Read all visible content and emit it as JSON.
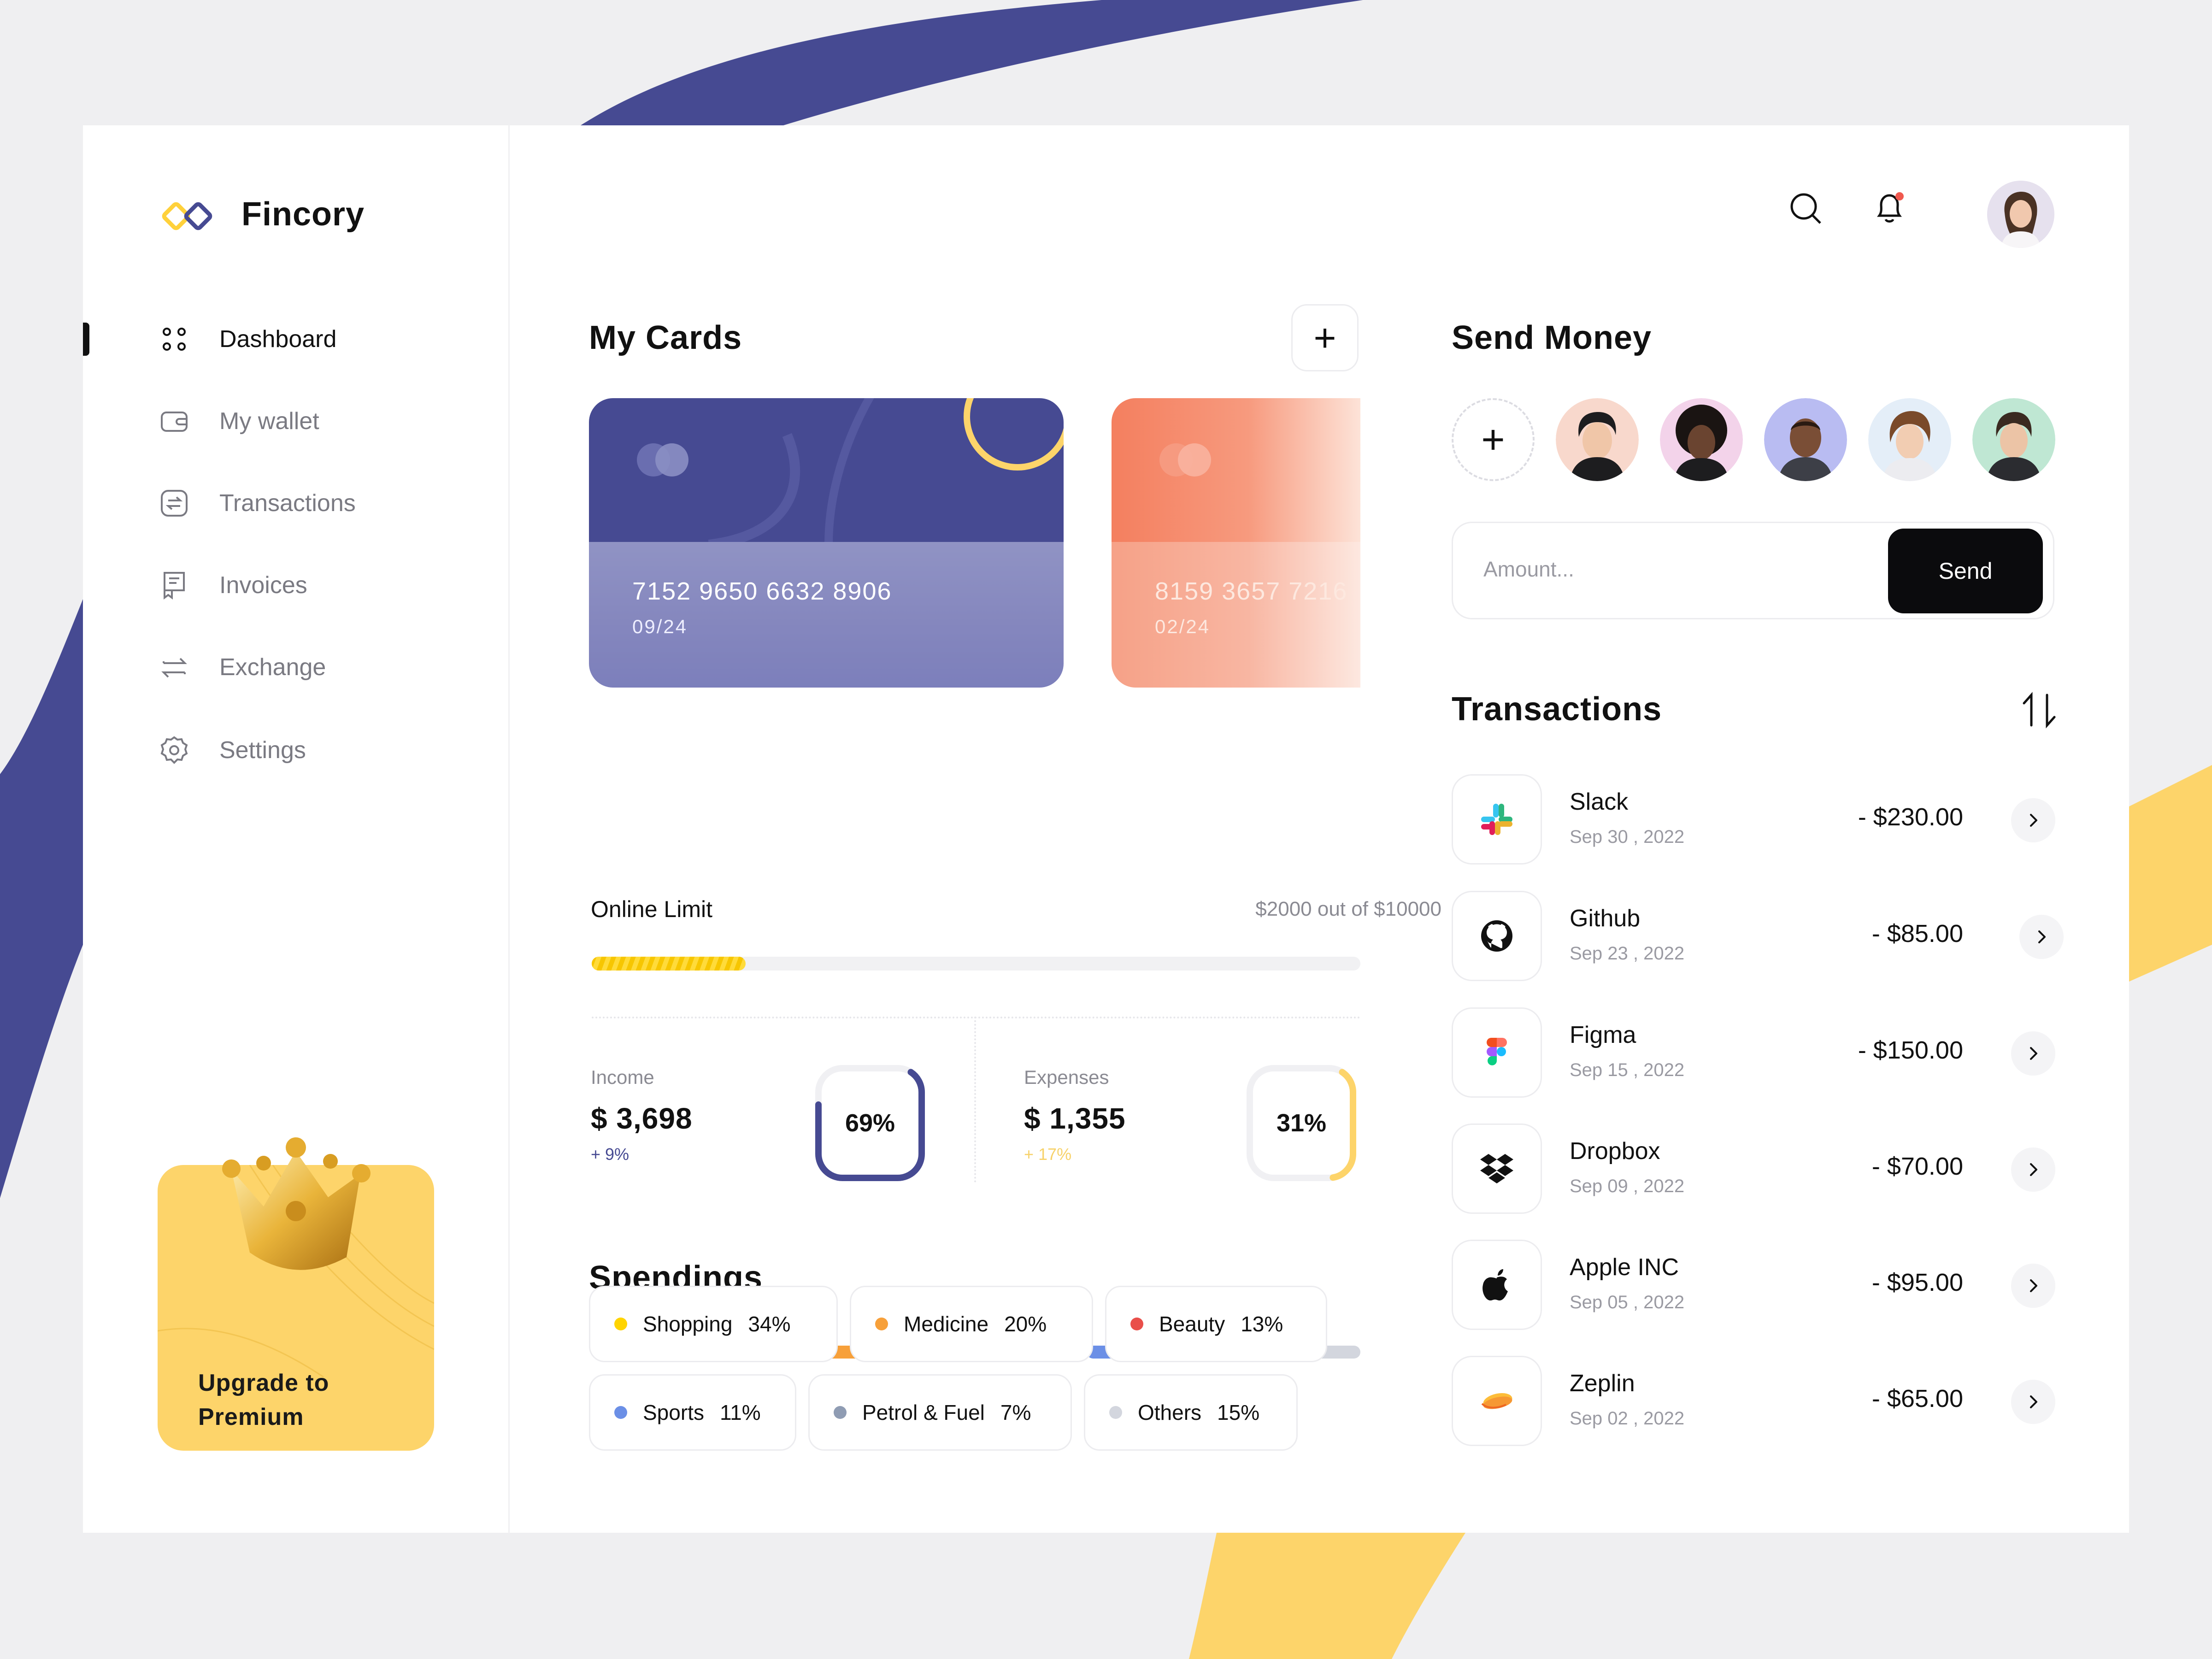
{
  "brand": {
    "name": "Fincory"
  },
  "colors": {
    "indigo": "#464a92",
    "yellow": "#fdd46a",
    "card_orange": "#f47f5f",
    "ink": "#111111",
    "muted": "#7a7a82"
  },
  "sidebar": {
    "items": [
      {
        "label": "Dashboard",
        "icon": "grid-icon",
        "active": true
      },
      {
        "label": "My wallet",
        "icon": "wallet-icon",
        "active": false
      },
      {
        "label": "Transactions",
        "icon": "transfer-icon",
        "active": false
      },
      {
        "label": "Invoices",
        "icon": "invoice-icon",
        "active": false
      },
      {
        "label": "Exchange",
        "icon": "exchange-icon",
        "active": false
      },
      {
        "label": "Settings",
        "icon": "gear-icon",
        "active": false
      }
    ],
    "premium": {
      "label": "Upgrade to Premium",
      "icon": "crown-icon"
    }
  },
  "header": {
    "icons": [
      "search-icon",
      "bell-icon",
      "avatar"
    ],
    "notification_dot": true
  },
  "cards_section": {
    "title": "My Cards",
    "add_label": "+",
    "cards": [
      {
        "number": "7152 9650 6632 8906",
        "expiry": "09/24",
        "color": "#464a92"
      },
      {
        "number": "8159 3657 7216",
        "expiry": "02/24",
        "color": "#f47f5f"
      }
    ]
  },
  "online_limit": {
    "label": "Online Limit",
    "value": "$2000 out of $10000",
    "progress": 0.2
  },
  "stats": {
    "income": {
      "label": "Income",
      "value": "$ 3,698",
      "delta": "+ 9%",
      "percent_label": "69%",
      "percent": 0.69
    },
    "expenses": {
      "label": "Expenses",
      "value": "$ 1,355",
      "delta": "+ 17%",
      "percent_label": "31%",
      "percent": 0.31
    }
  },
  "spendings": {
    "title": "Spendings",
    "categories": [
      {
        "name": "Shopping",
        "pct": "34%",
        "color": "#ffd400"
      },
      {
        "name": "Medicine",
        "pct": "20%",
        "color": "#f7a03a"
      },
      {
        "name": "Beauty",
        "pct": "13%",
        "color": "#e94f4a"
      },
      {
        "name": "Sports",
        "pct": "11%",
        "color": "#6b8fe6"
      },
      {
        "name": "Petrol & Fuel",
        "pct": "7%",
        "color": "#8f9cb3"
      },
      {
        "name": "Others",
        "pct": "15%",
        "color": "#d3d6de"
      }
    ]
  },
  "send_money": {
    "title": "Send Money",
    "add_label": "+",
    "amount_placeholder": "Amount...",
    "send_label": "Send"
  },
  "transactions": {
    "title": "Transactions",
    "items": [
      {
        "name": "Slack",
        "date": "Sep 30 , 2022",
        "amount": "- $230.00",
        "icon": "slack-icon"
      },
      {
        "name": "Github",
        "date": "Sep 23 , 2022",
        "amount": "- $85.00",
        "icon": "github-icon"
      },
      {
        "name": "Figma",
        "date": "Sep 15 , 2022",
        "amount": "- $150.00",
        "icon": "figma-icon"
      },
      {
        "name": "Dropbox",
        "date": "Sep 09 , 2022",
        "amount": "- $70.00",
        "icon": "dropbox-icon"
      },
      {
        "name": "Apple INC",
        "date": "Sep 05 , 2022",
        "amount": "- $95.00",
        "icon": "apple-icon"
      },
      {
        "name": "Zeplin",
        "date": "Sep 02 , 2022",
        "amount": "- $65.00",
        "icon": "zeplin-icon"
      }
    ]
  }
}
